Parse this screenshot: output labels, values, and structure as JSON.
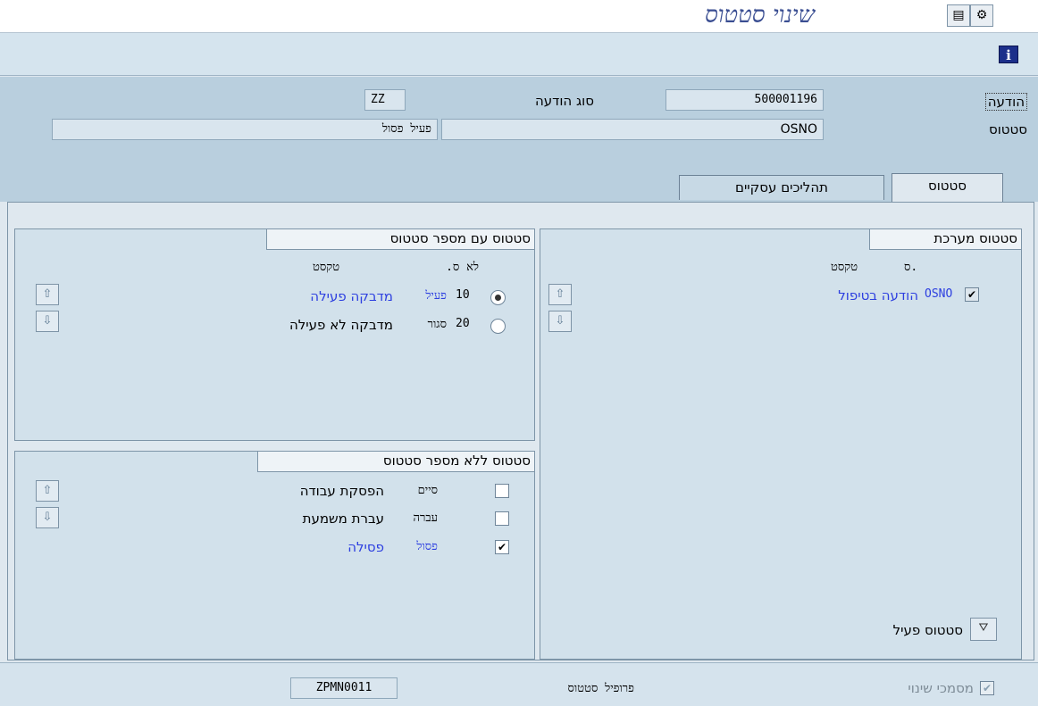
{
  "window": {
    "title": "שינוי סטטוס"
  },
  "header": {
    "notification_label": "הודעה",
    "notification_value": "500001196",
    "type_label": "סוג הודעה",
    "type_value": "ZZ",
    "status_label": "סטטוס",
    "status_value": "OSNO",
    "status_text": "פעיל פסול"
  },
  "tabs": [
    {
      "label": "סטטוס",
      "active": true
    },
    {
      "label": "תהליכים עסקיים",
      "active": false
    }
  ],
  "system_status": {
    "title": "סטטוס מערכת",
    "col_s": "ס.",
    "col_text": "טקסט",
    "rows": [
      {
        "code": "OSNO",
        "text": "הודעה בטיפול",
        "checked": true
      }
    ],
    "active_status_label": "סטטוס פעיל"
  },
  "numbered_status": {
    "title": "סטטוס עם מספר סטטוס",
    "col_no": "לא ס.",
    "col_text": "טקסט",
    "rows": [
      {
        "num": "10",
        "code": "פעיל",
        "text": "מדבקה פעילה",
        "selected": true
      },
      {
        "num": "20",
        "code": "סגור",
        "text": "מדבקה לא פעילה",
        "selected": false
      }
    ]
  },
  "unnumbered_status": {
    "title": "סטטוס ללא מספר סטטוס",
    "rows": [
      {
        "code": "סיים",
        "text": "הפסקת עבודה",
        "checked": false
      },
      {
        "code": "עברה",
        "text": "עברת משמעת",
        "checked": false
      },
      {
        "code": "פסול",
        "text": "פסילה",
        "checked": true
      }
    ]
  },
  "footer": {
    "change_docs_label": "מסמכי שינוי",
    "profile_label": "פרופיל סטטוס",
    "profile_value": "ZPMN0011"
  },
  "colors": {
    "link_blue": "#2d3fe0",
    "title_blue": "#3a4e92"
  }
}
